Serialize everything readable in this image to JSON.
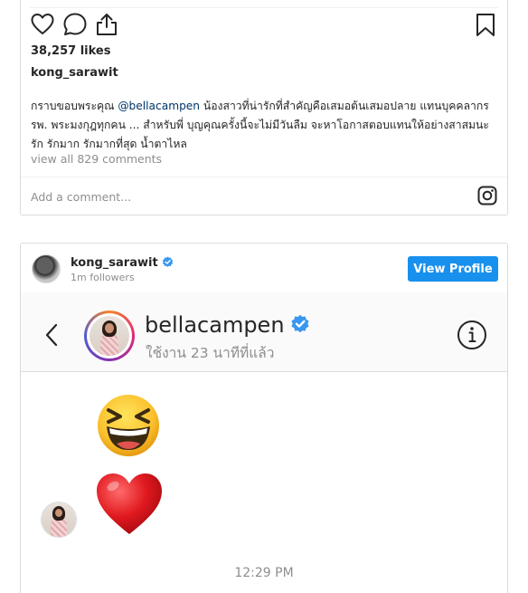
{
  "post1": {
    "likes": "38,257 likes",
    "username": "kong_sarawit",
    "caption_part1": "กราบขอบพระคุณ ",
    "caption_mention": "@bellacampen",
    "caption_part2": " น้องสาวที่น่ารักที่สำคัญคือเสมอต้นเสมอปลาย แทนบุคคลากร รพ. พระมงกุฎทุกคน ... สำหรับพี่ บุญคุณครั้งนี้จะไม่มีวันลืม จะหาโอกาสตอบแทนให้อย่างสาสมนะ รัก รักมาก รักมากที่สุด น้ำตาไหล",
    "view_comments": "view all 829 comments",
    "add_comment_placeholder": "Add a comment..."
  },
  "post2": {
    "username": "kong_sarawit",
    "followers": "1m followers",
    "view_profile_label": "View Profile"
  },
  "dm": {
    "contact_name": "bellacampen",
    "status": "ใช้งาน 23 นาทีที่แล้ว",
    "messages": [
      {
        "type": "emoji",
        "emoji": "grinning-squinting-face"
      },
      {
        "type": "emoji",
        "emoji": "red-heart"
      }
    ],
    "timestamp": "12:29 PM"
  },
  "colors": {
    "accent": "#1890ee",
    "verified": "#3897f0",
    "muted": "#8e8e8e",
    "mention": "#003569"
  },
  "icons": [
    "heart-icon",
    "comment-icon",
    "share-icon",
    "bookmark-icon",
    "instagram-icon",
    "verified-icon",
    "back-chevron-icon",
    "info-icon"
  ]
}
